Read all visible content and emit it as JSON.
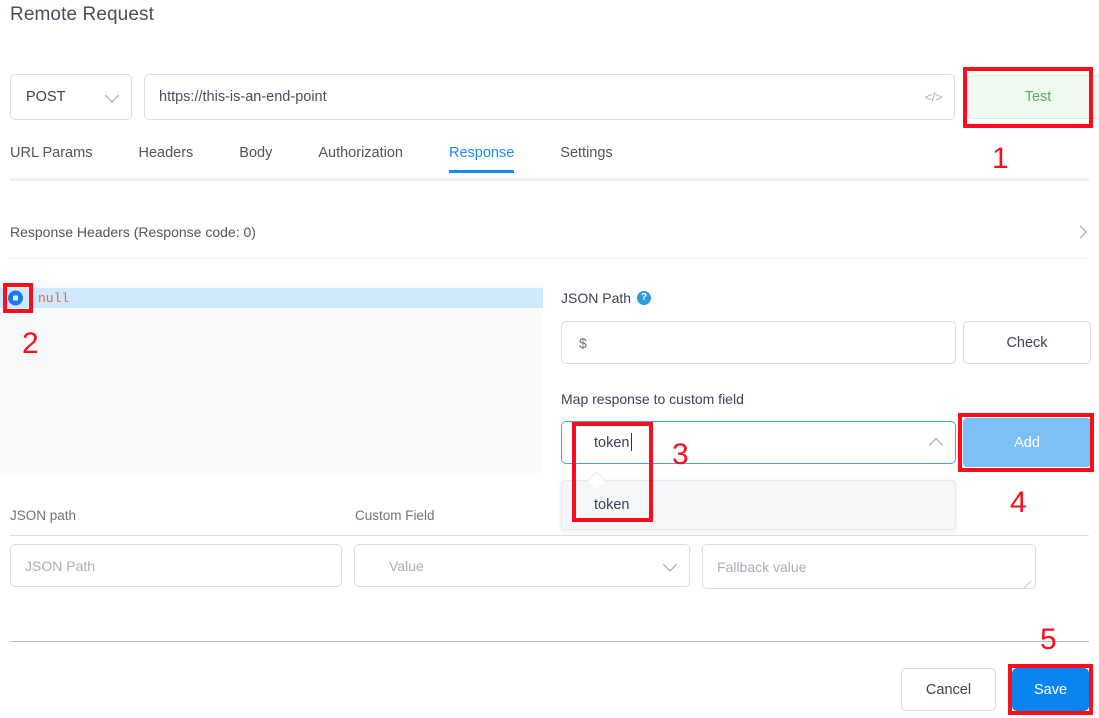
{
  "page_title": "Remote Request",
  "request_bar": {
    "method": "POST",
    "method_chevron_icon": "chevron-down-icon",
    "url_value": "https://this-is-an-end-point",
    "code_icon": "code-icon",
    "code_icon_glyph": "</>",
    "test_label": "Test",
    "test_color": "#53b453",
    "test_background": "#f0f9f0"
  },
  "tabs": [
    {
      "label": "URL Params",
      "active": false
    },
    {
      "label": "Headers",
      "active": false
    },
    {
      "label": "Body",
      "active": false
    },
    {
      "label": "Authorization",
      "active": false
    },
    {
      "label": "Response",
      "active": true
    },
    {
      "label": "Settings",
      "active": false
    }
  ],
  "active_tab_color": "#1a8cf0",
  "response_headers": {
    "label": "Response Headers (Response code: 0)",
    "expand_icon": "chevron-right-icon"
  },
  "json_viewer": {
    "node_icon": "json-node-dot-icon",
    "value": "null",
    "value_color": "#f2603c",
    "highlight_color": "#cfeafc",
    "panel_background": "#f8fafb"
  },
  "json_path_section": {
    "label": "JSON Path",
    "help_icon": "help-circle-icon",
    "help_icon_glyph": "?",
    "input_value": "$",
    "check_label": "Check"
  },
  "mapping_section": {
    "label": "Map response to custom field",
    "combo_value": "token",
    "combo_chevron_icon": "chevron-up-icon",
    "add_label": "Add",
    "add_background": "#7cc0f7",
    "dropdown_options": [
      "token"
    ]
  },
  "mapping_table": {
    "headers": [
      "JSON path",
      "Custom Field"
    ],
    "row": {
      "json_path_placeholder": "JSON Path",
      "value_placeholder": "Value",
      "value_chevron_icon": "chevron-down-icon",
      "fallback_placeholder": "Fallback value",
      "resize_icon": "resize-handle-icon"
    }
  },
  "footer": {
    "cancel_label": "Cancel",
    "save_label": "Save",
    "save_background": "#0a84f0"
  },
  "annotations": {
    "color": "#fc0d1b",
    "numbers": [
      "1",
      "2",
      "3",
      "4",
      "5"
    ]
  }
}
